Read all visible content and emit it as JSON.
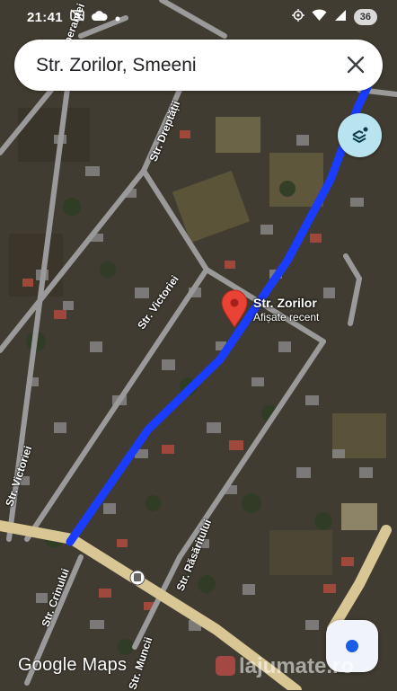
{
  "status_bar": {
    "time": "21:41",
    "battery": "36",
    "icons": [
      "no-photo-icon",
      "cloud-icon",
      "dot-icon",
      "location-icon",
      "wifi-icon",
      "signal-icon"
    ]
  },
  "search": {
    "query": "Str. Zorilor, Smeeni",
    "close_icon": "close-icon"
  },
  "map": {
    "pin": {
      "title": "Str. Zorilor",
      "subtitle": "Afișate recent"
    },
    "streets": {
      "sperantei": "Str. Speranței",
      "dreptatii": "Str. Dreptății",
      "victoriei_1": "Str. Victoriei",
      "victoriei_2": "Str. Victoriei",
      "crinului": "Str. Crinului",
      "rasaritului": "Str. Răsăritului",
      "muncii": "Str. Muncii"
    },
    "route_color": "#1a3cff",
    "pin_color": "#e94335"
  },
  "branding": {
    "logo": "Google Maps",
    "watermark": "lajumate.ro"
  },
  "controls": {
    "layers_icon": "layers-icon",
    "locate_icon": "my-location-icon"
  }
}
